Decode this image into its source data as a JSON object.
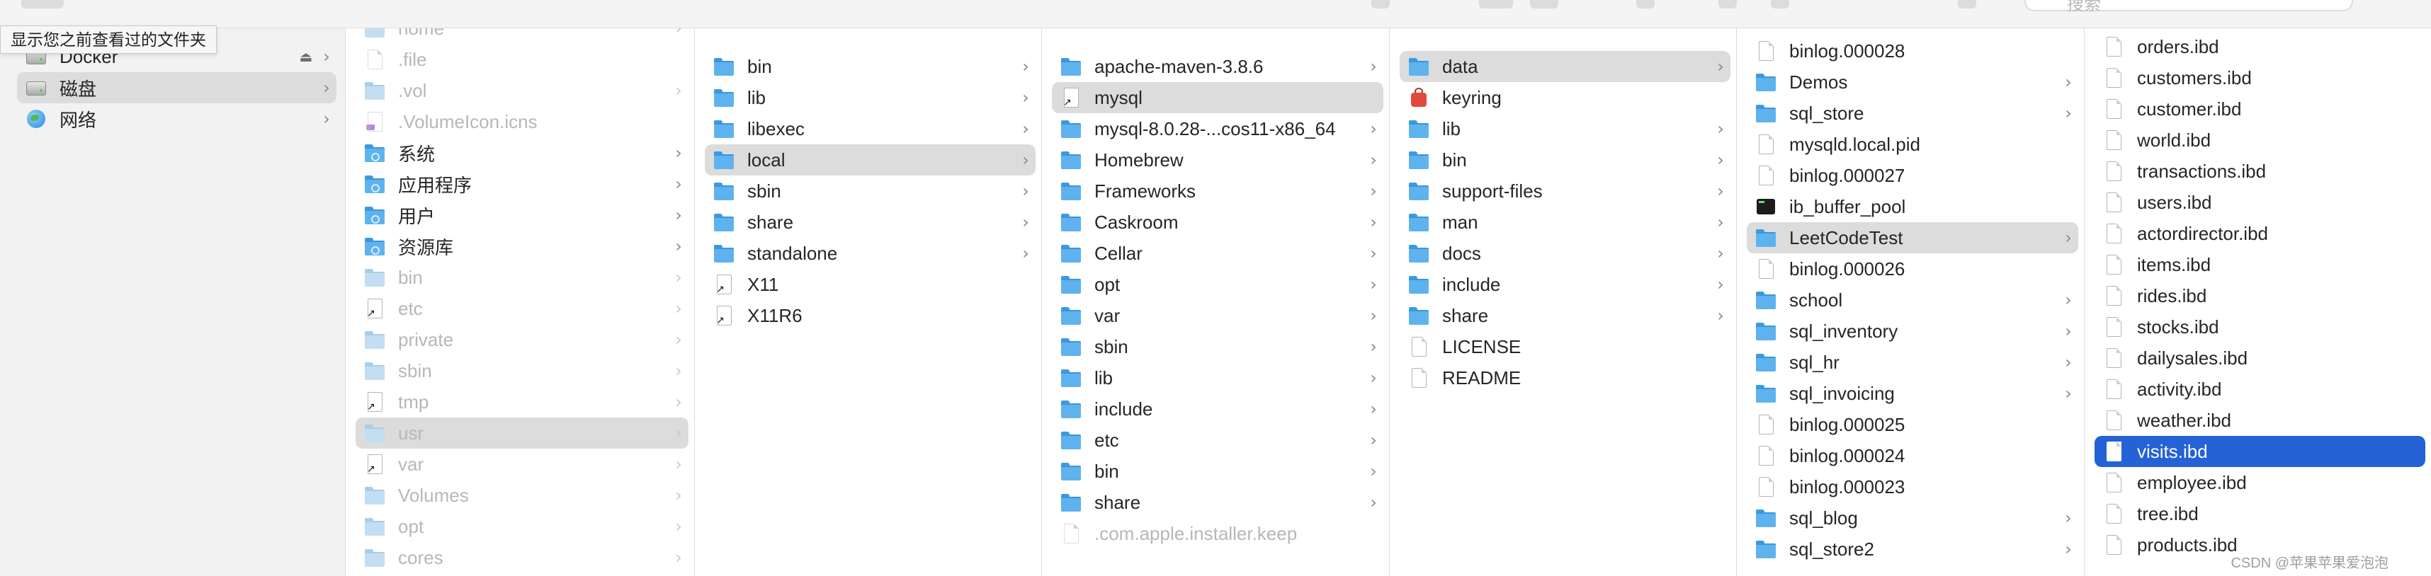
{
  "window": {
    "search_placeholder": "搜索",
    "tooltip": "显示您之前查看过的文件夹",
    "watermark": "CSDN @苹果苹果爱泡泡"
  },
  "colors": {
    "selection_blue": "#2462d6",
    "selection_gray": "#dcdcdc",
    "folder_blue": "#5eb3ee"
  },
  "sidebar": {
    "items": [
      {
        "label": "Docker",
        "icon": "disk-icon",
        "eject": true,
        "chevron": true,
        "selected": false
      },
      {
        "label": "磁盘",
        "icon": "disk-icon",
        "eject": false,
        "chevron": true,
        "selected": true
      },
      {
        "label": "网络",
        "icon": "globe-icon",
        "eject": false,
        "chevron": true,
        "selected": false
      }
    ]
  },
  "columns": [
    {
      "name": "root",
      "items": [
        {
          "label": "home",
          "icon": "folder",
          "chevron": true,
          "dim": true
        },
        {
          "label": ".file",
          "icon": "file",
          "chevron": false,
          "dim": true
        },
        {
          "label": ".vol",
          "icon": "folder",
          "chevron": true,
          "dim": true
        },
        {
          "label": ".VolumeIcon.icns",
          "icon": "icns",
          "chevron": false,
          "dim": true
        },
        {
          "label": "系统",
          "icon": "folder-sys",
          "chevron": true,
          "dim": false
        },
        {
          "label": "应用程序",
          "icon": "folder-sys",
          "chevron": true,
          "dim": false
        },
        {
          "label": "用户",
          "icon": "folder-sys",
          "chevron": true,
          "dim": false
        },
        {
          "label": "资源库",
          "icon": "folder-sys",
          "chevron": true,
          "dim": false
        },
        {
          "label": "bin",
          "icon": "folder",
          "chevron": true,
          "dim": true
        },
        {
          "label": "etc",
          "icon": "alias",
          "chevron": true,
          "dim": true
        },
        {
          "label": "private",
          "icon": "folder",
          "chevron": true,
          "dim": true
        },
        {
          "label": "sbin",
          "icon": "folder",
          "chevron": true,
          "dim": true
        },
        {
          "label": "tmp",
          "icon": "alias",
          "chevron": true,
          "dim": true
        },
        {
          "label": "usr",
          "icon": "folder",
          "chevron": true,
          "dim": true,
          "selected": "gray"
        },
        {
          "label": "var",
          "icon": "alias",
          "chevron": true,
          "dim": true
        },
        {
          "label": "Volumes",
          "icon": "folder",
          "chevron": true,
          "dim": true
        },
        {
          "label": "opt",
          "icon": "folder",
          "chevron": true,
          "dim": true
        },
        {
          "label": "cores",
          "icon": "folder",
          "chevron": true,
          "dim": true
        }
      ]
    },
    {
      "name": "usr",
      "items": [
        {
          "label": "bin",
          "icon": "folder",
          "chevron": true
        },
        {
          "label": "lib",
          "icon": "folder",
          "chevron": true
        },
        {
          "label": "libexec",
          "icon": "folder",
          "chevron": true
        },
        {
          "label": "local",
          "icon": "folder",
          "chevron": true,
          "selected": "gray"
        },
        {
          "label": "sbin",
          "icon": "folder",
          "chevron": true
        },
        {
          "label": "share",
          "icon": "folder",
          "chevron": true
        },
        {
          "label": "standalone",
          "icon": "folder",
          "chevron": true
        },
        {
          "label": "X11",
          "icon": "alias",
          "chevron": false
        },
        {
          "label": "X11R6",
          "icon": "alias",
          "chevron": false
        }
      ]
    },
    {
      "name": "local",
      "items": [
        {
          "label": "apache-maven-3.8.6",
          "icon": "folder",
          "chevron": true
        },
        {
          "label": "mysql",
          "icon": "alias",
          "chevron": false,
          "selected": "gray"
        },
        {
          "label": "mysql-8.0.28-...cos11-x86_64",
          "icon": "folder",
          "chevron": true
        },
        {
          "label": "Homebrew",
          "icon": "folder",
          "chevron": true
        },
        {
          "label": "Frameworks",
          "icon": "folder",
          "chevron": true
        },
        {
          "label": "Caskroom",
          "icon": "folder",
          "chevron": true
        },
        {
          "label": "Cellar",
          "icon": "folder",
          "chevron": true
        },
        {
          "label": "opt",
          "icon": "folder",
          "chevron": true
        },
        {
          "label": "var",
          "icon": "folder",
          "chevron": true
        },
        {
          "label": "sbin",
          "icon": "folder",
          "chevron": true
        },
        {
          "label": "lib",
          "icon": "folder",
          "chevron": true
        },
        {
          "label": "include",
          "icon": "folder",
          "chevron": true
        },
        {
          "label": "etc",
          "icon": "folder",
          "chevron": true
        },
        {
          "label": "bin",
          "icon": "folder",
          "chevron": true
        },
        {
          "label": "share",
          "icon": "folder",
          "chevron": true
        },
        {
          "label": ".com.apple.installer.keep",
          "icon": "file",
          "chevron": false,
          "dim": true
        }
      ]
    },
    {
      "name": "mysql",
      "items": [
        {
          "label": "data",
          "icon": "folder",
          "chevron": true,
          "selected": "gray"
        },
        {
          "label": "keyring",
          "icon": "keyring",
          "chevron": false
        },
        {
          "label": "lib",
          "icon": "folder",
          "chevron": true
        },
        {
          "label": "bin",
          "icon": "folder",
          "chevron": true
        },
        {
          "label": "support-files",
          "icon": "folder",
          "chevron": true
        },
        {
          "label": "man",
          "icon": "folder",
          "chevron": true
        },
        {
          "label": "docs",
          "icon": "folder",
          "chevron": true
        },
        {
          "label": "include",
          "icon": "folder",
          "chevron": true
        },
        {
          "label": "share",
          "icon": "folder",
          "chevron": true
        },
        {
          "label": "LICENSE",
          "icon": "file",
          "chevron": false
        },
        {
          "label": "README",
          "icon": "file",
          "chevron": false
        }
      ]
    },
    {
      "name": "data",
      "items": [
        {
          "label": "binlog.000028",
          "icon": "file",
          "chevron": false
        },
        {
          "label": "Demos",
          "icon": "folder",
          "chevron": true
        },
        {
          "label": "sql_store",
          "icon": "folder",
          "chevron": true
        },
        {
          "label": "mysqld.local.pid",
          "icon": "file",
          "chevron": false
        },
        {
          "label": "binlog.000027",
          "icon": "file",
          "chevron": false
        },
        {
          "label": "ib_buffer_pool",
          "icon": "exec",
          "chevron": false
        },
        {
          "label": "LeetCodeTest",
          "icon": "folder",
          "chevron": true,
          "selected": "gray"
        },
        {
          "label": "binlog.000026",
          "icon": "file",
          "chevron": false
        },
        {
          "label": "school",
          "icon": "folder",
          "chevron": true
        },
        {
          "label": "sql_inventory",
          "icon": "folder",
          "chevron": true
        },
        {
          "label": "sql_hr",
          "icon": "folder",
          "chevron": true
        },
        {
          "label": "sql_invoicing",
          "icon": "folder",
          "chevron": true
        },
        {
          "label": "binlog.000025",
          "icon": "file",
          "chevron": false
        },
        {
          "label": "binlog.000024",
          "icon": "file",
          "chevron": false
        },
        {
          "label": "binlog.000023",
          "icon": "file",
          "chevron": false
        },
        {
          "label": "sql_blog",
          "icon": "folder",
          "chevron": true
        },
        {
          "label": "sql_store2",
          "icon": "folder",
          "chevron": true
        }
      ]
    },
    {
      "name": "LeetCodeTest",
      "items": [
        {
          "label": "orders.ibd",
          "icon": "file",
          "chevron": false
        },
        {
          "label": "customers.ibd",
          "icon": "file",
          "chevron": false
        },
        {
          "label": "customer.ibd",
          "icon": "file",
          "chevron": false
        },
        {
          "label": "world.ibd",
          "icon": "file",
          "chevron": false
        },
        {
          "label": "transactions.ibd",
          "icon": "file",
          "chevron": false
        },
        {
          "label": "users.ibd",
          "icon": "file",
          "chevron": false
        },
        {
          "label": "actordirector.ibd",
          "icon": "file",
          "chevron": false
        },
        {
          "label": "items.ibd",
          "icon": "file",
          "chevron": false
        },
        {
          "label": "rides.ibd",
          "icon": "file",
          "chevron": false
        },
        {
          "label": "stocks.ibd",
          "icon": "file",
          "chevron": false
        },
        {
          "label": "dailysales.ibd",
          "icon": "file",
          "chevron": false
        },
        {
          "label": "activity.ibd",
          "icon": "file",
          "chevron": false
        },
        {
          "label": "weather.ibd",
          "icon": "file",
          "chevron": false
        },
        {
          "label": "visits.ibd",
          "icon": "file",
          "chevron": false,
          "selected": "blue"
        },
        {
          "label": "employee.ibd",
          "icon": "file",
          "chevron": false
        },
        {
          "label": "tree.ibd",
          "icon": "file",
          "chevron": false
        },
        {
          "label": "products.ibd",
          "icon": "file",
          "chevron": false
        }
      ]
    }
  ]
}
